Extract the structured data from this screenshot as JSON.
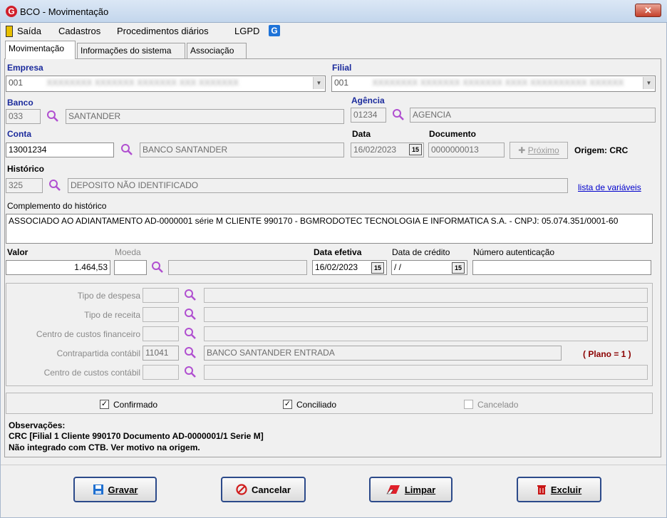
{
  "window": {
    "title": "BCO - Movimentação",
    "close": "✕",
    "logo": "G"
  },
  "menu": {
    "items": [
      "Saída",
      "Cadastros",
      "Procedimentos diários",
      "LGPD"
    ]
  },
  "tabs": [
    "Movimentação",
    "Informações do sistema",
    "Associação"
  ],
  "labels": {
    "empresa": "Empresa",
    "filial": "Filial",
    "banco": "Banco",
    "agencia": "Agência",
    "conta": "Conta",
    "data": "Data",
    "documento": "Documento",
    "historico": "Histórico",
    "complemento": "Complemento do histórico",
    "valor": "Valor",
    "moeda": "Moeda",
    "data_efetiva": "Data efetiva",
    "data_credito": "Data de crédito",
    "numero_autenticacao": "Número autenticação",
    "tipo_despesa": "Tipo de despesa",
    "tipo_receita": "Tipo de receita",
    "centro_fin": "Centro de custos financeiro",
    "contrapartida": "Contrapartida contábil",
    "centro_contabil": "Centro de custos contábil"
  },
  "fields": {
    "empresa_code": "001",
    "empresa_name": "XXXXXXXX XXXXXXX XXXXXXX XXX XXXXXXX",
    "filial_code": "001",
    "filial_name": "XXXXXXXX XXXXXXX XXXXXXX XXXX XXXXXXXXXX XXXXXX",
    "banco_code": "033",
    "banco_name": "SANTANDER",
    "agencia_code": "01234",
    "agencia_name": "AGENCIA",
    "conta_code": "13001234",
    "conta_name": "BANCO SANTANDER",
    "data": "16/02/2023",
    "documento": "0000000013",
    "proximo": "Próximo",
    "origem": "Origem: CRC",
    "historico_code": "325",
    "historico_name": "DEPOSITO NÃO IDENTIFICADO",
    "lista_variaveis": "lista de variáveis",
    "complemento": "ASSOCIADO AO ADIANTAMENTO AD-0000001 série M CLIENTE 990170 - BGMRODOTEC TECNOLOGIA E INFORMATICA S.A. - CNPJ: 05.074.351/0001-60",
    "valor": "1.464,53",
    "moeda_code": "",
    "moeda_name": "",
    "data_efetiva": "16/02/2023",
    "data_credito": " / /",
    "numero_autenticacao": "",
    "contrapartida_code": "11041",
    "contrapartida_name": "BANCO SANTANDER ENTRADA",
    "plano": "( Plano = 1 )",
    "cal_icon": "15"
  },
  "checks": [
    {
      "label": "Confirmado",
      "checked": true,
      "enabled": true
    },
    {
      "label": "Conciliado",
      "checked": true,
      "enabled": true
    },
    {
      "label": "Cancelado",
      "checked": false,
      "enabled": false
    }
  ],
  "observacoes": {
    "title": "Observações:",
    "line1": "CRC [Filial 1 Cliente 990170 Documento AD-0000001/1 Serie M]",
    "line2": "Não integrado com CTB. Ver motivo na origem."
  },
  "buttons": {
    "gravar": "Gravar",
    "cancelar": "Cancelar",
    "limpar": "Limpar",
    "excluir": "Excluir"
  },
  "colors": {
    "accent_label": "#1a2a9c",
    "plano": "#8b0000",
    "search_icon": "#b04fd0",
    "close_btn": "#c4402b"
  }
}
